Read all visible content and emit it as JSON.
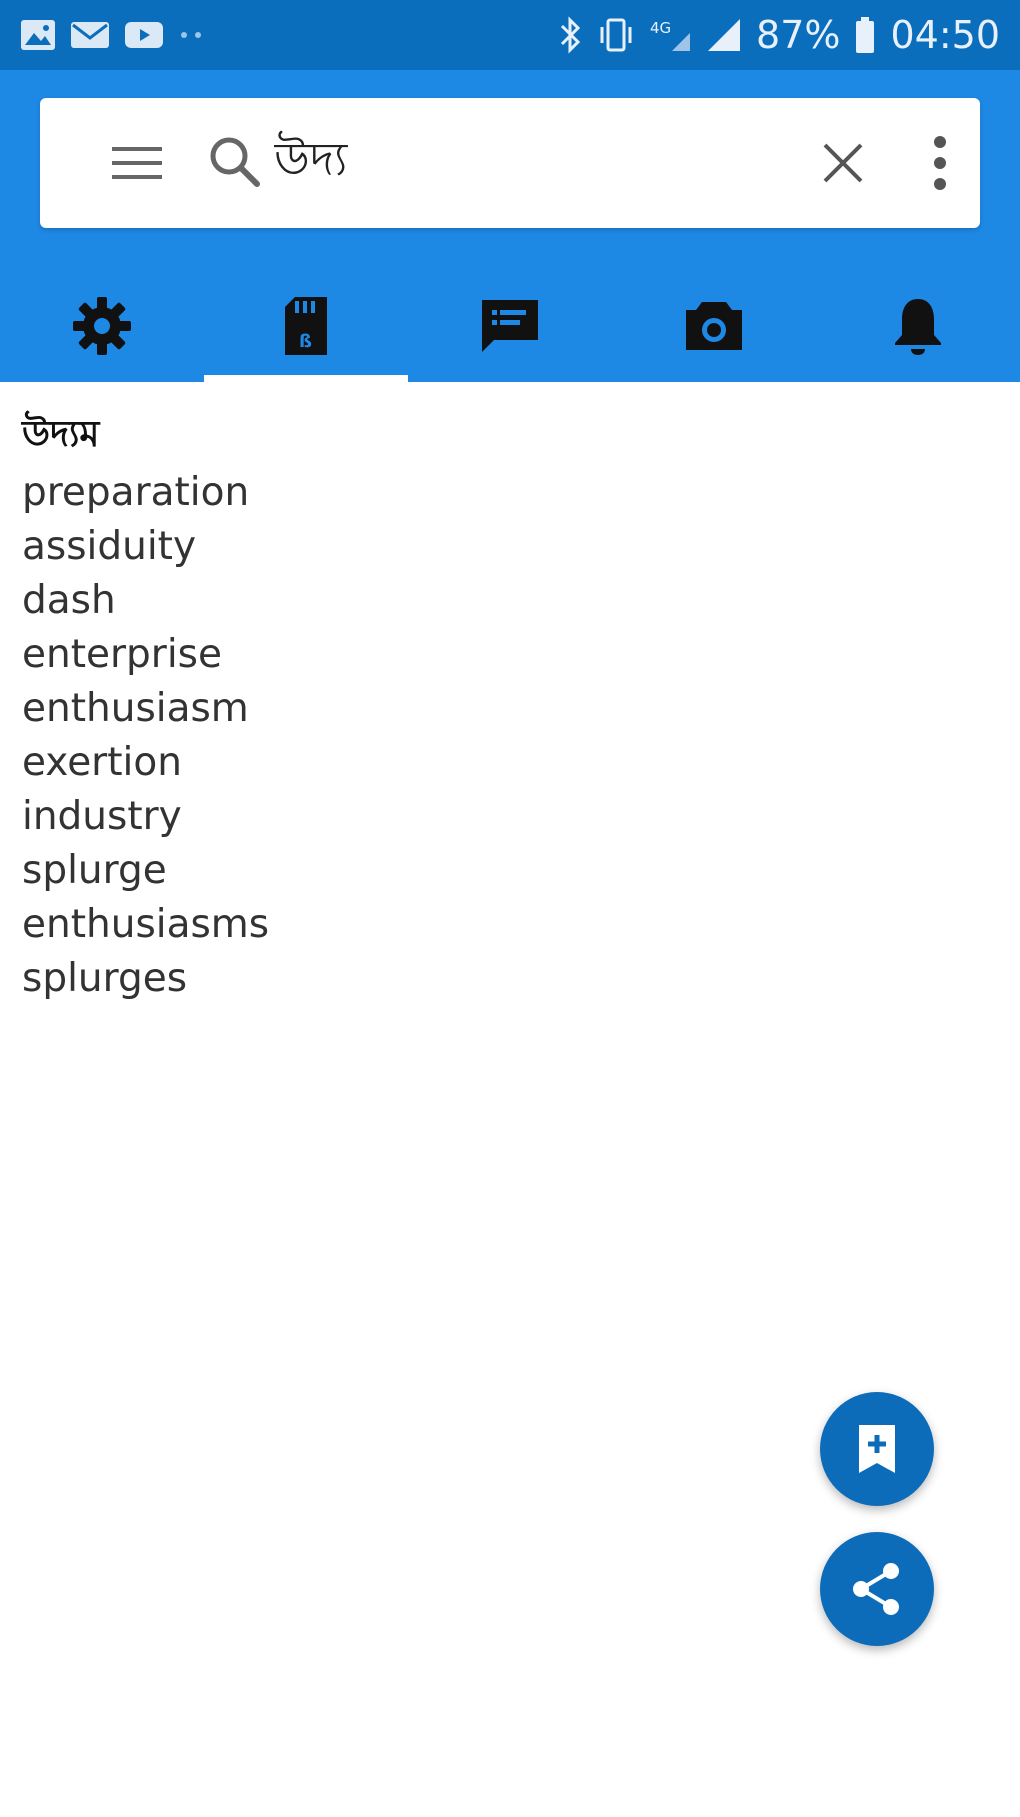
{
  "status_bar": {
    "battery": "87%",
    "time": "04:50",
    "left_icons": [
      "gallery-icon",
      "email-icon",
      "youtube-icon",
      "more-notifications-icon"
    ],
    "right_icons": [
      "bluetooth-icon",
      "vibrate-icon",
      "signal-4g-icon",
      "signal-bars-icon",
      "battery-icon"
    ]
  },
  "colors": {
    "status_bar": "#0a6ebd",
    "header": "#1e88e5",
    "fab": "#0d6cb9",
    "tab_icon": "#111111"
  },
  "search": {
    "value": "উদ্য"
  },
  "tabs": [
    {
      "icon": "settings-icon",
      "active": false
    },
    {
      "icon": "sd-card-icon",
      "active": true
    },
    {
      "icon": "chat-icon",
      "active": false
    },
    {
      "icon": "camera-icon",
      "active": false
    },
    {
      "icon": "notification-bell-icon",
      "active": false
    }
  ],
  "results": {
    "heading": "উদ্যম",
    "items": [
      "preparation",
      "assiduity",
      "dash",
      "enterprise",
      "enthusiasm",
      "exertion",
      "industry",
      "splurge",
      "enthusiasms",
      "splurges"
    ]
  },
  "fabs": {
    "bookmark_icon": "bookmark-add-icon",
    "share_icon": "share-icon"
  }
}
